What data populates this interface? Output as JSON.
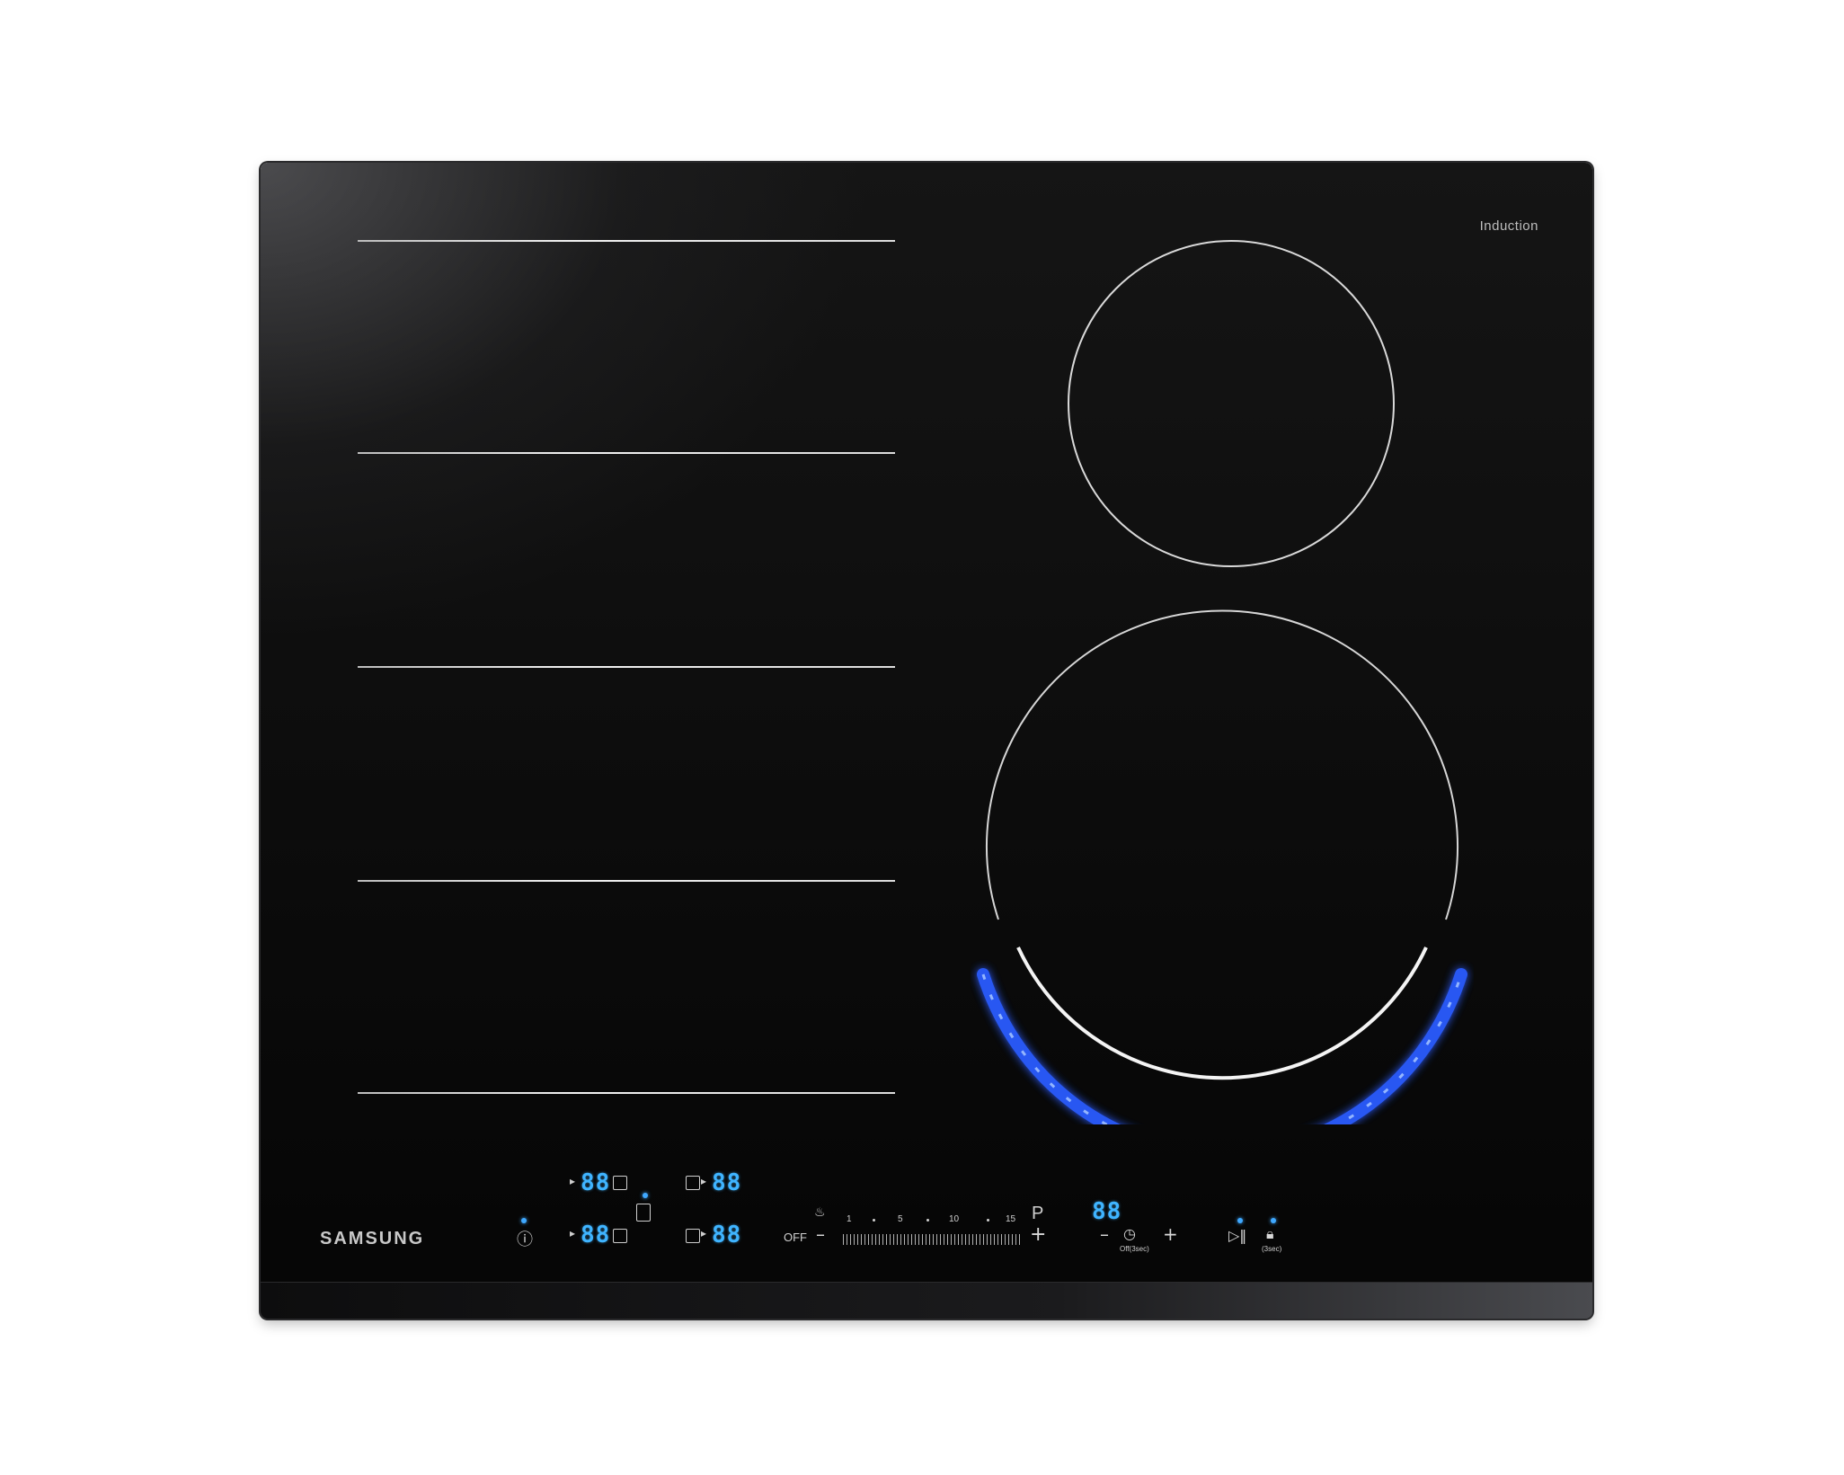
{
  "appliance": {
    "brand": "SAMSUNG",
    "type_label": "Induction",
    "flex_zone_lines": 5
  },
  "controls": {
    "zone_displays": [
      "88",
      "88",
      "88",
      "88"
    ],
    "timer_display": "88",
    "off_label": "OFF",
    "power_boost_label": "P",
    "scale_labels": [
      "1",
      "5",
      "10",
      "15"
    ],
    "timer_off_label": "Off(3sec)",
    "lock_label": "(3sec)"
  },
  "icons": {
    "info": "info-icon",
    "keep_warm": "keep-warm-icon",
    "timer": "clock-icon",
    "pause": "play-pause-icon",
    "lock": "lock-icon"
  },
  "colors": {
    "display_blue": "#3fb4ff",
    "flame_ring_blue": "#2a5cff",
    "glass": "#050505"
  }
}
